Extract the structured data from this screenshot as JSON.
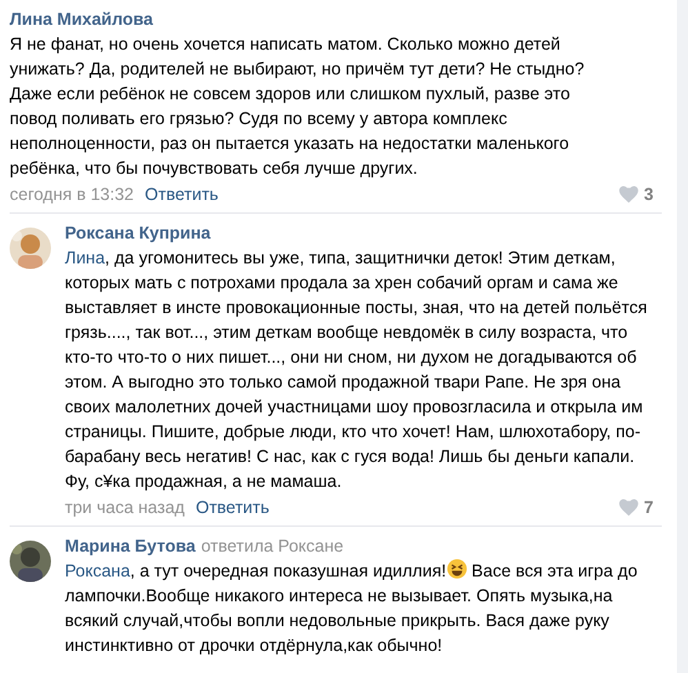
{
  "comments": [
    {
      "author": "Лина Михайлова",
      "avatar": false,
      "parts": [
        {
          "kind": "text",
          "text": "Я не фанат, но очень хочется написать матом. Сколько можно детей унижать? Да, родителей не выбирают, но причём тут дети? Не стыдно? Даже если ребёнок не совсем здоров или слишком пухлый, разве это повод поливать его грязью? Судя по всему у автора комплекс неполноценности, раз он пытается указать на недостатки маленького ребёнка, что бы почувствовать себя лучше других."
        }
      ],
      "time": "сегодня в 13:32",
      "reply": "Ответить",
      "likes": "3"
    },
    {
      "author": "Роксана Куприна",
      "avatar": true,
      "parts": [
        {
          "kind": "mention",
          "text": "Лина"
        },
        {
          "kind": "text",
          "text": ", да угомонитесь вы уже, типа, защитнички деток! Этим деткам, которых мать с потрохами продала за хрен собачий оргам и сама же выставляет в инсте провокационные посты, зная, что на детей польётся грязь...., так вот..., этим деткам вообще невдомёк в силу возраста, что кто-то что-то о них пишет..., они ни сном, ни духом не догадываются об этом. А выгодно это только самой продажной твари Рапе. Не зря она своих малолетних дочей участницами шоу провозгласила и открыла им страницы. Пишите, добрые люди, кто что хочет! Нам, шлюхотабору, по-барабану весь негатив! С нас, как с гуся вода! Лишь бы деньги капали. Фу, с¥ка продажная, а не мамаша."
        }
      ],
      "time": "три часа назад",
      "reply": "Ответить",
      "likes": "7"
    },
    {
      "author": "Марина Бутова",
      "reply_to": "ответила Роксане",
      "avatar": true,
      "parts": [
        {
          "kind": "mention",
          "text": "Роксана"
        },
        {
          "kind": "text",
          "text": ", а тут очередная показушная идиллия!"
        },
        {
          "kind": "emoji"
        },
        {
          "kind": "text",
          "text": " Васе вся эта игра до лампочки.Вообще никакого интереса не вызывает. Опять музыка,на всякий случай,чтобы вопли недовольные прикрыть. Вася даже руку инстинктивно от дрочки отдёрнула,как обычно!"
        }
      ]
    }
  ]
}
